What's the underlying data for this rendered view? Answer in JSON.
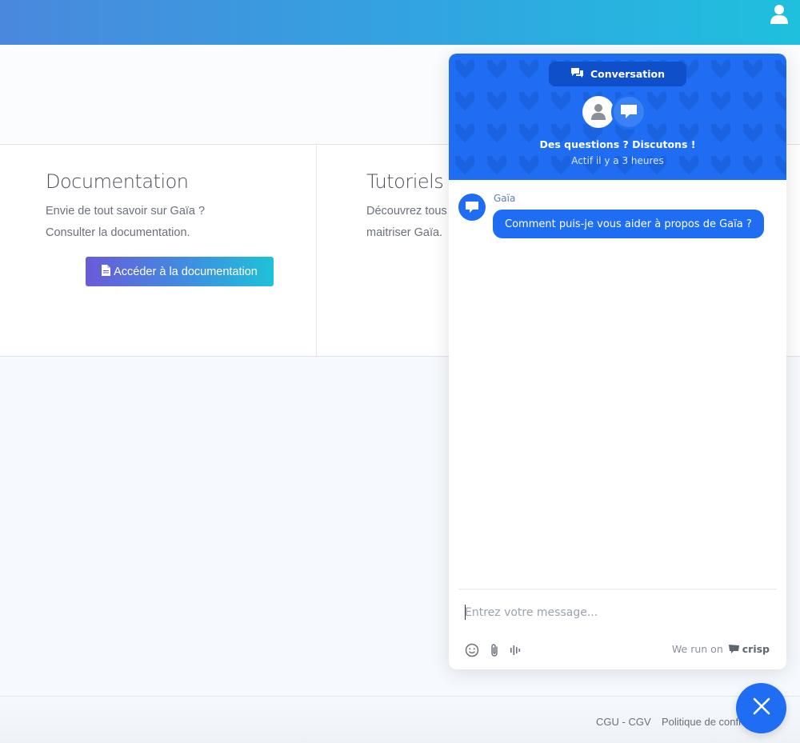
{
  "documentation": {
    "title": "Documentation",
    "line1": "Envie de tout savoir sur Gaïa ?",
    "line2": "Consulter la documentation.",
    "button_label": "Accéder à la documentation"
  },
  "tutorials": {
    "title": "Tutoriels",
    "line1": "Découvrez tous",
    "line2": "maitriser Gaïa."
  },
  "footer": {
    "cgu": "CGU - CGV",
    "privacy": "Politique de confi"
  },
  "chat": {
    "tab_label": "Conversation",
    "header_title": "Des questions ? Discutons !",
    "header_subtitle": "Actif il y a 3 heures",
    "message": {
      "sender": "Gaïa",
      "text": "Comment puis-je vous aider à propos de Gaïa ?"
    },
    "composer_placeholder": "Entrez votre message...",
    "branding_prefix": "We run on",
    "branding_name": "crisp",
    "accent_color": "#1f6df2"
  },
  "icons": {
    "user": "user-icon",
    "document": "document-icon",
    "conversation": "conversation-icon",
    "emoji": "emoji-icon",
    "attach": "paperclip-icon",
    "audio": "audio-waveform-icon",
    "close": "close-icon"
  }
}
